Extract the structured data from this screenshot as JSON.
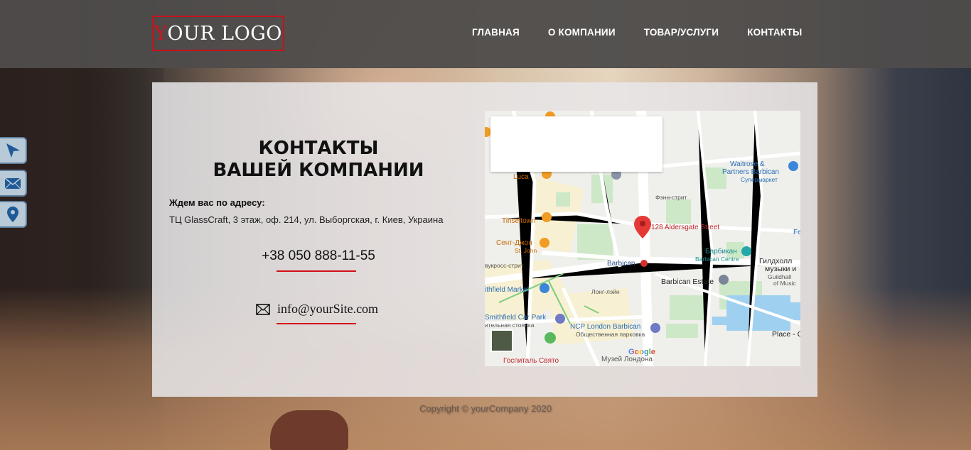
{
  "header": {
    "logo": {
      "first_letter": "Y",
      "rest": "OUR LOGO"
    },
    "nav": [
      "ГЛАВНАЯ",
      "О КОМПАНИИ",
      "ТОВАР/УСЛУГИ",
      "КОНТАКТЫ"
    ]
  },
  "side_widgets": [
    "navigation-arrow-icon",
    "mail-icon",
    "location-pin-icon"
  ],
  "contacts": {
    "title_line1": "КОНТАКТЫ",
    "title_line2": "ВАШЕЙ КОМПАНИИ",
    "address_label": "Ждем вас по адресу:",
    "address": "ТЦ GlassCraft, 3 этаж, оф. 214, ул. Выборгская, г. Киев, Украина",
    "phone": "+38 050 888-11-55",
    "email": "info@yourSite.com"
  },
  "map": {
    "marker_label": "128 Aldersgate Street",
    "labels": {
      "luca": "Luca",
      "tinseltown": "Tinseltown",
      "sent_dzhon": "Сент-Джон",
      "st_john": "St. John",
      "smithfield_market": "ithfield Market",
      "smithfield_car_park": "Smithfield Car Park",
      "car_park_ru": "ительная стоянка",
      "ncp": "NCP London Barbican",
      "ncp_ru": "Общественная парковка",
      "barbican": "Barbican",
      "barbican_estate": "Barbican Estate",
      "barbikan": "Барбикан",
      "barbican_centre": "Barbican Centre",
      "waitrose": "Waitrose &",
      "partners": "Partners Barbican",
      "supermarket": "Супермаркет",
      "guildhall_1": "Гилдхолл",
      "guildhall_2": "музыки и",
      "guildhall_3": "Guildhall",
      "guildhall_4": "of Music",
      "place": "Place - C",
      "hospital": "Госпиталь Свято",
      "museum": "Музей Лондона",
      "krossstrit": "вукросс-стрит",
      "long_lane": "Лонг-лэйн",
      "fenn_street": "Фэнн-стрит",
      "fe": "Fe",
      "google": "Google"
    }
  },
  "footer": {
    "copyright": "Copyright © yourCompany 2020"
  },
  "colors": {
    "accent": "#d10f18",
    "header_bg": "#4e4c4b"
  }
}
